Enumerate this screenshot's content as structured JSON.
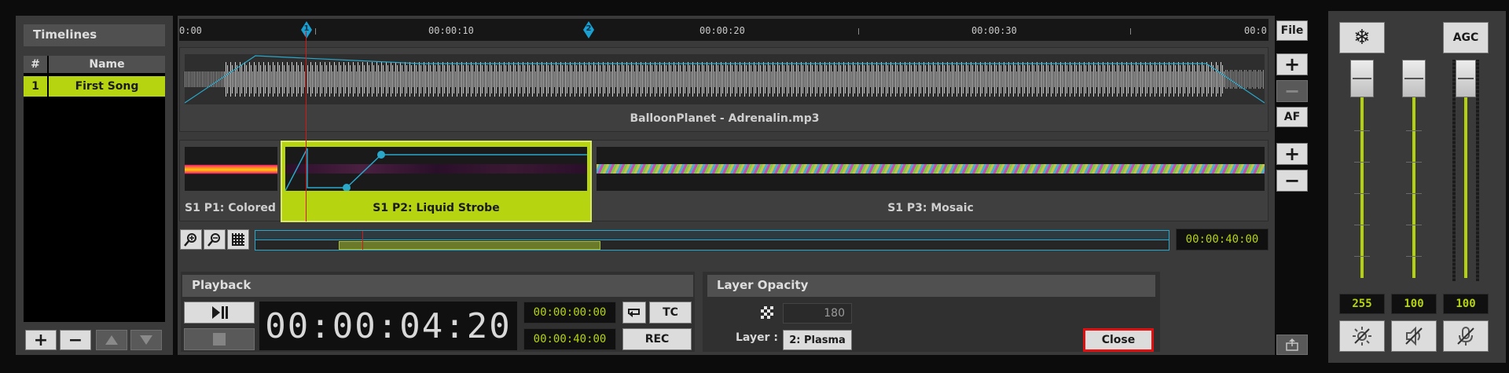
{
  "colors": {
    "accent": "#b6d40f",
    "panel": "#3a3a3a",
    "dark": "#141414",
    "cyan": "#2ba7c9",
    "close_border": "#e01010"
  },
  "timelines": {
    "title": "Timelines",
    "columns": [
      "#",
      "Name"
    ],
    "rows": [
      {
        "num": "1",
        "name": "First Song"
      }
    ]
  },
  "ruler": {
    "labels": [
      "0:00",
      "00:00:10",
      "00:00:20",
      "00:00:30",
      "00:0"
    ],
    "markers": [
      "1",
      "2"
    ]
  },
  "audio": {
    "track_name": "BalloonPlanet - Adrenalin.mp3"
  },
  "clips": [
    {
      "label": "S1 P1: Colored"
    },
    {
      "label": "S1 P2: Liquid Strobe"
    },
    {
      "label": "S1 P3: Mosaic"
    }
  ],
  "right_tools": {
    "file": "File",
    "af": "AF",
    "plus": "+",
    "minus": "−"
  },
  "zoom": {
    "duration": "00:00:40:00"
  },
  "playback": {
    "title": "Playback",
    "time": "00:00:04:20",
    "start": "00:00:00:00",
    "end": "00:00:40:00",
    "tc": "TC",
    "rec": "REC"
  },
  "layer_opacity": {
    "title": "Layer Opacity",
    "value": "180",
    "layer_label": "Layer :",
    "layer_value": "2: Plasma",
    "close": "Close"
  },
  "master": {
    "agc": "AGC",
    "values": [
      "255",
      "100",
      "100"
    ]
  }
}
